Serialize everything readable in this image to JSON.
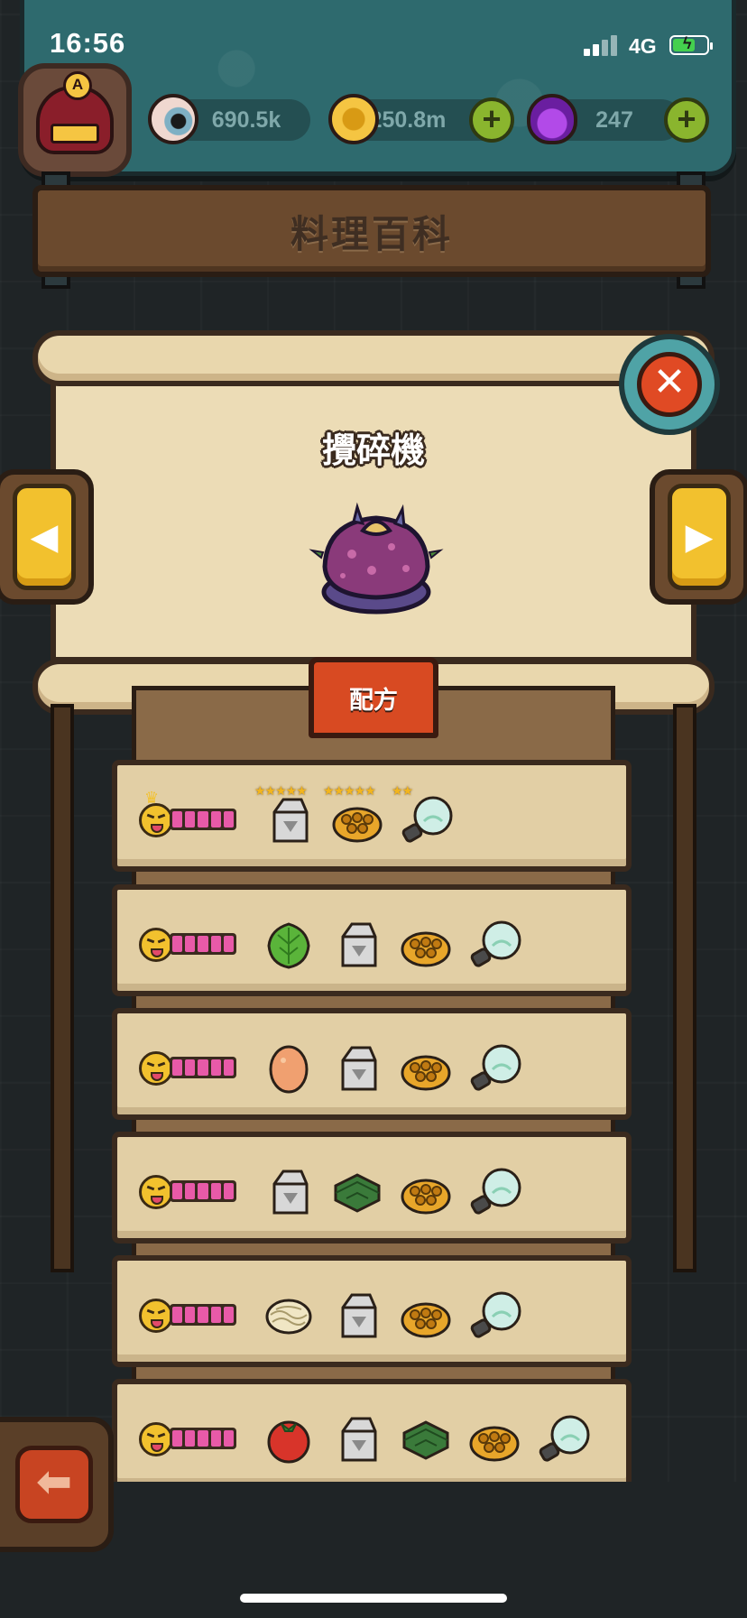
{
  "status": {
    "time": "16:56",
    "network": "4G"
  },
  "resources": [
    {
      "value": "690.5k",
      "icon": "eyeball-icon",
      "has_plus": false
    },
    {
      "value": "250.8m",
      "icon": "gold-coin-icon",
      "has_plus": true
    },
    {
      "value": "247",
      "icon": "potion-icon",
      "has_plus": true
    }
  ],
  "avatar_badge": "A",
  "page_title": "料理百科",
  "dish": {
    "name": "攪碎機",
    "icon": "purple-dish-icon"
  },
  "recipe_tab_label": "配方",
  "nav": {
    "prev": "◀",
    "next": "▶",
    "close": "✕",
    "back": "⬅"
  },
  "recipes": [
    {
      "crowned": true,
      "rating": 5,
      "ingredients": [
        "milk-carton",
        "honeycomb",
        "light-bulb"
      ],
      "stars": [
        "★★★★★",
        "★★★★★",
        "★★"
      ]
    },
    {
      "crowned": false,
      "rating": 5,
      "ingredients": [
        "lettuce",
        "milk-carton",
        "honeycomb",
        "light-bulb"
      ],
      "stars": []
    },
    {
      "crowned": false,
      "rating": 5,
      "ingredients": [
        "egg",
        "milk-carton",
        "honeycomb",
        "light-bulb"
      ],
      "stars": []
    },
    {
      "crowned": false,
      "rating": 5,
      "ingredients": [
        "milk-carton",
        "seaweed",
        "honeycomb",
        "light-bulb"
      ],
      "stars": []
    },
    {
      "crowned": false,
      "rating": 5,
      "ingredients": [
        "noodles",
        "milk-carton",
        "honeycomb",
        "light-bulb"
      ],
      "stars": []
    },
    {
      "crowned": false,
      "rating": 5,
      "ingredients": [
        "tomato",
        "milk-carton",
        "seaweed",
        "honeycomb",
        "light-bulb"
      ],
      "stars": []
    }
  ]
}
